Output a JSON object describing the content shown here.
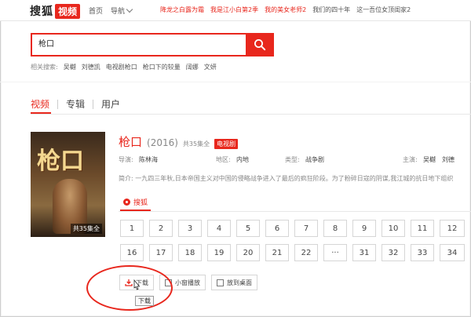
{
  "header": {
    "logo_text": "搜狐",
    "logo_badge": "视频",
    "nav": [
      "首页",
      "导航"
    ],
    "hot_links": [
      "降龙之白露为霜",
      "我是江小白第2季",
      "我的美女老师2",
      "我们的四十年",
      "这一吾位女顶闺家2"
    ]
  },
  "search": {
    "value": "枪口"
  },
  "related": {
    "label": "相关搜索:",
    "items": [
      "吴樾",
      "刘德凯",
      "电视剧枪口",
      "枪口下的较量",
      "阔娜",
      "文妍"
    ]
  },
  "tabs": [
    "视频",
    "专辑",
    "用户"
  ],
  "show": {
    "title": "枪口",
    "year": "(2016)",
    "count": "共35集全",
    "tag": "电视剧",
    "poster_title": "枪口",
    "poster_badge": "共35集全",
    "director_label": "导演:",
    "director": "陈林海",
    "region_label": "地区:",
    "region": "内地",
    "type_label": "类型:",
    "type": "战争剧",
    "cast_label": "主演:",
    "cast": [
      "吴樾",
      "刘德"
    ],
    "synopsis": "简介: 一九四三年秋,日本帝国主义对中国的侵略战争进入了最后的疯狂阶段。为了粉碎日寇的阴谋,我江城的抗日地下组织"
  },
  "source": {
    "label": "搜狐"
  },
  "episodes": {
    "row1": [
      "1",
      "2",
      "3",
      "4",
      "5",
      "6",
      "7",
      "8",
      "9",
      "10",
      "11",
      "12"
    ],
    "row2": [
      "16",
      "17",
      "18",
      "19",
      "20",
      "21",
      "22",
      "···",
      "31",
      "32",
      "33",
      "34"
    ]
  },
  "actions": {
    "download": "下载",
    "small_window": "小窗播放",
    "desktop": "放到桌面"
  },
  "tooltip": "下载",
  "colors": {
    "accent": "#e8271d"
  }
}
